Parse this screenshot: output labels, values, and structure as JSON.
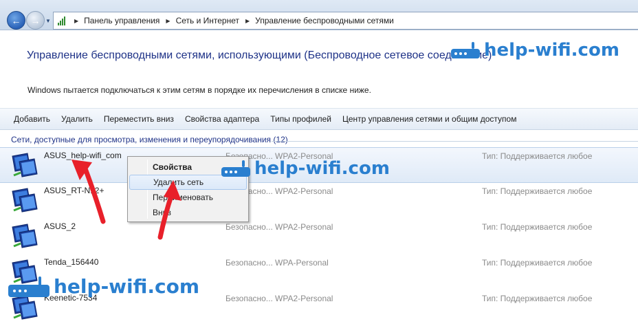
{
  "breadcrumb": {
    "items": [
      "Панель управления",
      "Сеть и Интернет",
      "Управление беспроводными сетями"
    ]
  },
  "header": {
    "title": "Управление беспроводными сетями, использующими (Беспроводное сетевое соединение)",
    "description": "Windows пытается подключаться к этим сетям в порядке их перечисления в списке ниже."
  },
  "toolbar": {
    "items": [
      "Добавить",
      "Удалить",
      "Переместить вниз",
      "Свойства адаптера",
      "Типы профилей",
      "Центр управления сетями и общим доступом"
    ]
  },
  "group_header": "Сети, доступные для просмотра, изменения и переупорядочивания (12)",
  "networks": [
    {
      "name": "ASUS_help-wifi_com",
      "security": "Безопасно...",
      "encryption": "WPA2-Personal",
      "type": "Тип:  Поддерживается любое"
    },
    {
      "name": "ASUS_RT-N12+",
      "security": "Безопасно...",
      "encryption": "WPA2-Personal",
      "type": "Тип:  Поддерживается любое"
    },
    {
      "name": "ASUS_2",
      "security": "Безопасно...",
      "encryption": "WPA2-Personal",
      "type": "Тип:  Поддерживается любое"
    },
    {
      "name": "Tenda_156440",
      "security": "Безопасно...",
      "encryption": "WPA-Personal",
      "type": "Тип:  Поддерживается любое"
    },
    {
      "name": "Keenetic-7534",
      "security": "Безопасно...",
      "encryption": "WPA2-Personal",
      "type": "Тип:  Поддерживается любое"
    }
  ],
  "context_menu": {
    "items": [
      "Свойства",
      "Удалить сеть",
      "Переименовать",
      "Вниз"
    ],
    "hovered_index": 1
  },
  "watermark": "help-wifi.com",
  "colors": {
    "title_blue": "#1e3287",
    "watermark_blue": "#2a7fcf",
    "arrow_red": "#e8202a"
  }
}
